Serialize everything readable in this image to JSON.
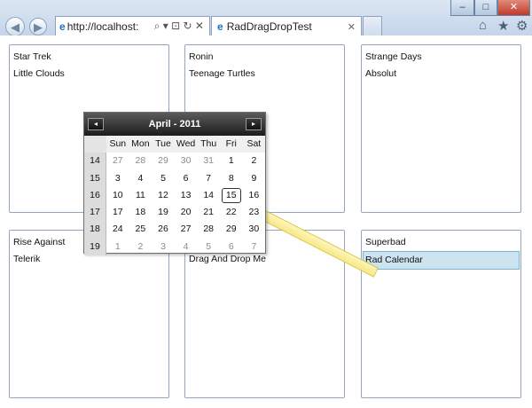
{
  "browser": {
    "address": "http://localhost:",
    "address_controls": "⌕ ▾ ⊡ ↻ ✕",
    "tab_title": "RadDragDropTest",
    "tab_close": "✕",
    "window_controls": {
      "minimize": "–",
      "maximize": "□",
      "close": "✕"
    },
    "toolbar_icons": [
      "home-icon",
      "favorites-star-icon",
      "gear-icon"
    ]
  },
  "panels": [
    {
      "items": [
        "Star Trek",
        "Little Clouds"
      ]
    },
    {
      "items": [
        "Ronin",
        "Teenage Turtles"
      ]
    },
    {
      "items": [
        "Strange Days",
        "Absolut"
      ]
    },
    {
      "items": [
        "Rise Against",
        "Telerik"
      ]
    },
    {
      "items": [
        "",
        "Drag And Drop Me"
      ]
    },
    {
      "items": [
        "Superbad",
        "Rad Calendar"
      ]
    }
  ],
  "calendar": {
    "title": "April - 2011",
    "prev": "◂",
    "next": "▸",
    "days_of_week": [
      "Sun",
      "Mon",
      "Tue",
      "Wed",
      "Thu",
      "Fri",
      "Sat"
    ],
    "weeks": [
      {
        "num": "14",
        "days": [
          "27",
          "28",
          "29",
          "30",
          "31",
          "1",
          "2"
        ]
      },
      {
        "num": "15",
        "days": [
          "3",
          "4",
          "5",
          "6",
          "7",
          "8",
          "9"
        ]
      },
      {
        "num": "16",
        "days": [
          "10",
          "11",
          "12",
          "13",
          "14",
          "15",
          "16"
        ]
      },
      {
        "num": "17",
        "days": [
          "17",
          "18",
          "19",
          "20",
          "21",
          "22",
          "23"
        ]
      },
      {
        "num": "18",
        "days": [
          "24",
          "25",
          "26",
          "27",
          "28",
          "29",
          "30"
        ]
      },
      {
        "num": "19",
        "days": [
          "1",
          "2",
          "3",
          "4",
          "5",
          "6",
          "7"
        ]
      }
    ],
    "other_month_cells": {
      "0": [
        0,
        1,
        2,
        3,
        4
      ],
      "5": [
        0,
        1,
        2,
        3,
        4,
        5,
        6
      ]
    },
    "today": "15"
  },
  "colors": {
    "selected_item_bg": "#cce4f0",
    "drag_cue": "#fbefa0",
    "calendar_header": "#2a2a2a"
  }
}
